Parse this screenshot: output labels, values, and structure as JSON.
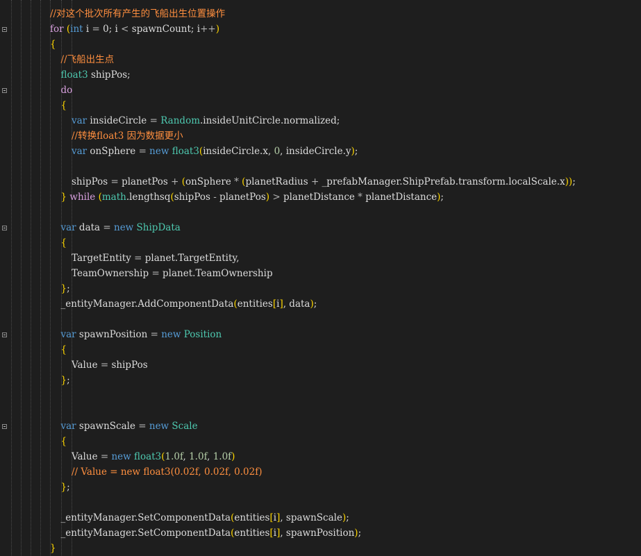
{
  "editor": {
    "language": "C#",
    "colors": {
      "background": "#1e1e1e",
      "keyword": "#569cd6",
      "control": "#d8a0df",
      "comment": "#ff8f3f",
      "type": "#4ec9b0",
      "number": "#b5cea8",
      "brace": "#ffd700",
      "identifier": "#dcdcdc"
    },
    "lines": [
      {
        "indent": 0,
        "tokens": [
          [
            "cm",
            "//对这个批次所有产生的飞船出生位置操作"
          ]
        ]
      },
      {
        "indent": 0,
        "fold": true,
        "tokens": [
          [
            "ctl",
            "for "
          ],
          [
            "br",
            "("
          ],
          [
            "kw",
            "int"
          ],
          [
            "id",
            " i "
          ],
          [
            "op",
            "="
          ],
          [
            "id",
            " 0; i "
          ],
          [
            "op",
            "<"
          ],
          [
            "id",
            " spawnCount; i"
          ],
          [
            "op",
            "++"
          ],
          [
            "br",
            ")"
          ]
        ]
      },
      {
        "indent": 0,
        "tokens": [
          [
            "br",
            "{"
          ]
        ]
      },
      {
        "indent": 1,
        "tokens": [
          [
            "cm",
            "//飞船出生点"
          ]
        ]
      },
      {
        "indent": 1,
        "tokens": [
          [
            "ty",
            "float3"
          ],
          [
            "id",
            " shipPos;"
          ]
        ]
      },
      {
        "indent": 1,
        "fold": true,
        "tokens": [
          [
            "ctl",
            "do"
          ]
        ]
      },
      {
        "indent": 1,
        "tokens": [
          [
            "br",
            "{"
          ]
        ]
      },
      {
        "indent": 2,
        "tokens": [
          [
            "kw",
            "var"
          ],
          [
            "id",
            " insideCircle "
          ],
          [
            "op",
            "="
          ],
          [
            "id",
            " "
          ],
          [
            "ty",
            "Random"
          ],
          [
            "id",
            ".insideUnitCircle.normalized;"
          ]
        ]
      },
      {
        "indent": 2,
        "tokens": [
          [
            "cm",
            "//转换float3 因为数据更小"
          ]
        ]
      },
      {
        "indent": 2,
        "tokens": [
          [
            "kw",
            "var"
          ],
          [
            "id",
            " onSphere "
          ],
          [
            "op",
            "="
          ],
          [
            "id",
            " "
          ],
          [
            "kw",
            "new"
          ],
          [
            "id",
            " "
          ],
          [
            "ty",
            "float3"
          ],
          [
            "br",
            "("
          ],
          [
            "id",
            "insideCircle.x, "
          ],
          [
            "num",
            "0"
          ],
          [
            "id",
            ", insideCircle.y"
          ],
          [
            "br",
            ")"
          ],
          [
            "id",
            ";"
          ]
        ]
      },
      {
        "indent": 2,
        "tokens": []
      },
      {
        "indent": 2,
        "tokens": [
          [
            "id",
            "shipPos "
          ],
          [
            "op",
            "="
          ],
          [
            "id",
            " planetPos "
          ],
          [
            "op",
            "+"
          ],
          [
            "id",
            " "
          ],
          [
            "br",
            "("
          ],
          [
            "id",
            "onSphere "
          ],
          [
            "op",
            "*"
          ],
          [
            "id",
            " "
          ],
          [
            "br",
            "("
          ],
          [
            "id",
            "planetRadius "
          ],
          [
            "op",
            "+"
          ],
          [
            "id",
            " _prefabManager.ShipPrefab.transform.localScale.x"
          ],
          [
            "br",
            "))"
          ],
          [
            "id",
            ";"
          ]
        ]
      },
      {
        "indent": 1,
        "tokens": [
          [
            "br",
            "}"
          ],
          [
            "id",
            " "
          ],
          [
            "ctl",
            "while"
          ],
          [
            "id",
            " "
          ],
          [
            "br",
            "("
          ],
          [
            "ty",
            "math"
          ],
          [
            "id",
            ".lengthsq"
          ],
          [
            "br",
            "("
          ],
          [
            "id",
            "shipPos "
          ],
          [
            "op",
            "-"
          ],
          [
            "id",
            " planetPos"
          ],
          [
            "br",
            ")"
          ],
          [
            "id",
            " "
          ],
          [
            "op",
            ">"
          ],
          [
            "id",
            " planetDistance "
          ],
          [
            "op",
            "*"
          ],
          [
            "id",
            " planetDistance"
          ],
          [
            "br",
            ")"
          ],
          [
            "id",
            ";"
          ]
        ]
      },
      {
        "indent": 1,
        "tokens": []
      },
      {
        "indent": 1,
        "fold": true,
        "tokens": [
          [
            "kw",
            "var"
          ],
          [
            "id",
            " data "
          ],
          [
            "op",
            "="
          ],
          [
            "id",
            " "
          ],
          [
            "kw",
            "new"
          ],
          [
            "id",
            " "
          ],
          [
            "ty",
            "ShipData"
          ]
        ]
      },
      {
        "indent": 1,
        "tokens": [
          [
            "br",
            "{"
          ]
        ]
      },
      {
        "indent": 2,
        "tokens": [
          [
            "id",
            "TargetEntity "
          ],
          [
            "op",
            "="
          ],
          [
            "id",
            " planet.TargetEntity,"
          ]
        ]
      },
      {
        "indent": 2,
        "tokens": [
          [
            "id",
            "TeamOwnership "
          ],
          [
            "op",
            "="
          ],
          [
            "id",
            " planet.TeamOwnership"
          ]
        ]
      },
      {
        "indent": 1,
        "tokens": [
          [
            "br",
            "}"
          ],
          [
            "id",
            ";"
          ]
        ]
      },
      {
        "indent": 1,
        "tokens": [
          [
            "id",
            "_entityManager.AddComponentData"
          ],
          [
            "br",
            "("
          ],
          [
            "id",
            "entities"
          ],
          [
            "br",
            "["
          ],
          [
            "id",
            "i"
          ],
          [
            "br",
            "]"
          ],
          [
            "id",
            ", data"
          ],
          [
            "br",
            ")"
          ],
          [
            "id",
            ";"
          ]
        ]
      },
      {
        "indent": 1,
        "tokens": []
      },
      {
        "indent": 1,
        "fold": true,
        "tokens": [
          [
            "kw",
            "var"
          ],
          [
            "id",
            " spawnPosition "
          ],
          [
            "op",
            "="
          ],
          [
            "id",
            " "
          ],
          [
            "kw",
            "new"
          ],
          [
            "id",
            " "
          ],
          [
            "ty",
            "Position"
          ]
        ]
      },
      {
        "indent": 1,
        "tokens": [
          [
            "br",
            "{"
          ]
        ]
      },
      {
        "indent": 2,
        "tokens": [
          [
            "id",
            "Value "
          ],
          [
            "op",
            "="
          ],
          [
            "id",
            " shipPos"
          ]
        ]
      },
      {
        "indent": 1,
        "tokens": [
          [
            "br",
            "}"
          ],
          [
            "id",
            ";"
          ]
        ]
      },
      {
        "indent": 1,
        "tokens": []
      },
      {
        "indent": 1,
        "tokens": []
      },
      {
        "indent": 1,
        "fold": true,
        "tokens": [
          [
            "kw",
            "var"
          ],
          [
            "id",
            " spawnScale "
          ],
          [
            "op",
            "="
          ],
          [
            "id",
            " "
          ],
          [
            "kw",
            "new"
          ],
          [
            "id",
            " "
          ],
          [
            "ty",
            "Scale"
          ]
        ]
      },
      {
        "indent": 1,
        "tokens": [
          [
            "br",
            "{"
          ]
        ]
      },
      {
        "indent": 2,
        "tokens": [
          [
            "id",
            "Value "
          ],
          [
            "op",
            "="
          ],
          [
            "id",
            " "
          ],
          [
            "kw",
            "new"
          ],
          [
            "id",
            " "
          ],
          [
            "ty",
            "float3"
          ],
          [
            "br",
            "("
          ],
          [
            "num",
            "1.0f"
          ],
          [
            "id",
            ", "
          ],
          [
            "num",
            "1.0f"
          ],
          [
            "id",
            ", "
          ],
          [
            "num",
            "1.0f"
          ],
          [
            "br",
            ")"
          ]
        ]
      },
      {
        "indent": 2,
        "tokens": [
          [
            "cm",
            "// Value = new float3(0.02f, 0.02f, 0.02f)"
          ]
        ]
      },
      {
        "indent": 1,
        "tokens": [
          [
            "br",
            "}"
          ],
          [
            "id",
            ";"
          ]
        ]
      },
      {
        "indent": 1,
        "tokens": []
      },
      {
        "indent": 1,
        "tokens": [
          [
            "id",
            "_entityManager.SetComponentData"
          ],
          [
            "br",
            "("
          ],
          [
            "id",
            "entities"
          ],
          [
            "br",
            "["
          ],
          [
            "id",
            "i"
          ],
          [
            "br",
            "]"
          ],
          [
            "id",
            ", spawnScale"
          ],
          [
            "br",
            ")"
          ],
          [
            "id",
            ";"
          ]
        ]
      },
      {
        "indent": 1,
        "tokens": [
          [
            "id",
            "_entityManager.SetComponentData"
          ],
          [
            "br",
            "("
          ],
          [
            "id",
            "entities"
          ],
          [
            "br",
            "["
          ],
          [
            "id",
            "i"
          ],
          [
            "br",
            "]"
          ],
          [
            "id",
            ", spawnPosition"
          ],
          [
            "br",
            ")"
          ],
          [
            "id",
            ";"
          ]
        ]
      },
      {
        "indent": 0,
        "tokens": [
          [
            "br",
            "}"
          ]
        ]
      }
    ]
  }
}
